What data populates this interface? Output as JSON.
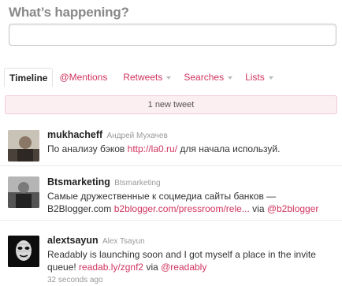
{
  "compose": {
    "title": "What’s happening?",
    "value": ""
  },
  "tabs": [
    {
      "label": "Timeline",
      "active": true,
      "dropdown": false
    },
    {
      "label": "@Mentions",
      "active": false,
      "dropdown": false
    },
    {
      "label": "Retweets",
      "active": false,
      "dropdown": true
    },
    {
      "label": "Searches",
      "active": false,
      "dropdown": true
    },
    {
      "label": "Lists",
      "active": false,
      "dropdown": true
    }
  ],
  "new_tweet_bar": "1 new tweet",
  "tweets": [
    {
      "screen_name": "mukhacheff",
      "full_name": "Андрей Мухачев",
      "text_before": "По анализу бэков ",
      "link1": "http://la0.ru/",
      "text_after": " для начала используй."
    },
    {
      "screen_name": "Btsmarketing",
      "full_name": "Btsmarketing",
      "text_before": "Самые дружественные к соцмедиа сайты банков — B2Blogger.com ",
      "link1": "b2blogger.com/pressroom/rele...",
      "text_mid": " via ",
      "link2": "@b2blogger"
    },
    {
      "screen_name": "alextsayun",
      "full_name": "Alex Tsayun",
      "text_before": "Readably is launching soon and I got myself a place in the invite queue! ",
      "link1": "readab.ly/zgnf2",
      "text_mid": " via ",
      "link2": "@readably",
      "time": "32 seconds ago"
    }
  ],
  "colors": {
    "link": "#d0345f",
    "new_tweet_bg": "#fbeff2",
    "muted": "#999999"
  }
}
